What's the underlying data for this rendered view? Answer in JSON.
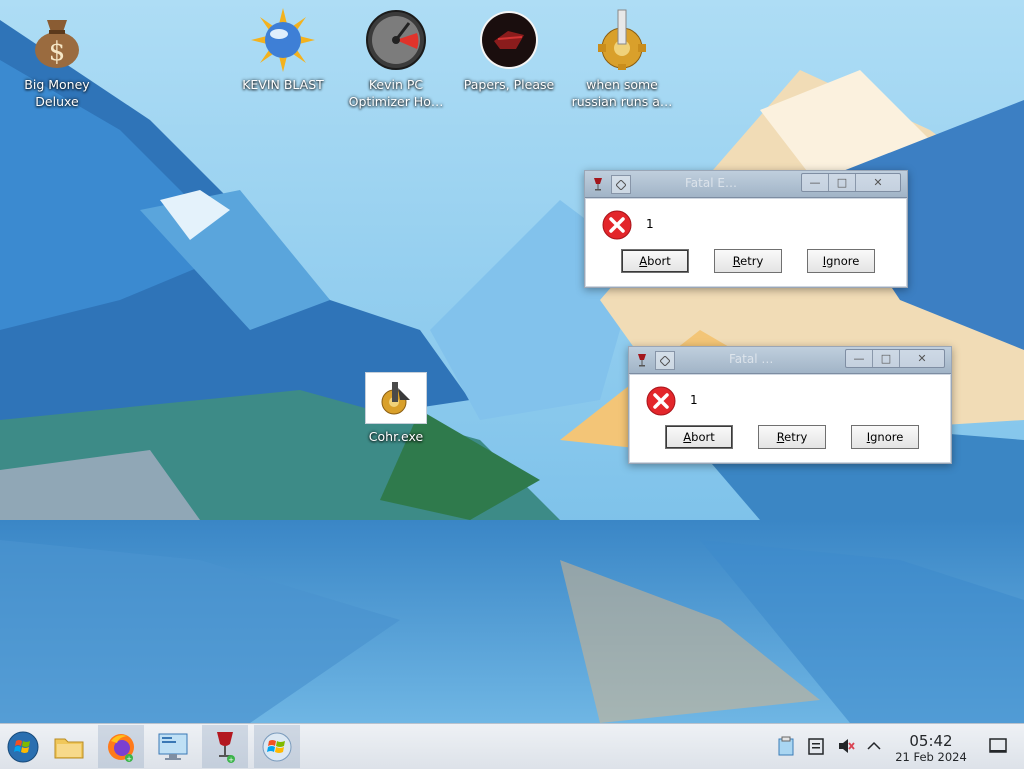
{
  "desktop": {
    "icons": [
      {
        "label": "Big Money Deluxe",
        "icon": "money-bag-icon"
      },
      {
        "label": "KEVIN BLAST",
        "icon": "sun-globe-icon"
      },
      {
        "label": "Kevin PC Optimizer Ho…",
        "icon": "speedometer-icon"
      },
      {
        "label": "Papers, Please",
        "icon": "papers-please-icon"
      },
      {
        "label": "when some russian runs a…",
        "icon": "gear-install-icon"
      },
      {
        "label": "Cohr.exe",
        "icon": "gear-install-icon"
      }
    ]
  },
  "dialogs": [
    {
      "title": "Fatal E…",
      "message": "1",
      "buttons": {
        "abort": "Abort",
        "retry": "Retry",
        "ignore": "Ignore"
      }
    },
    {
      "title": "Fatal …",
      "message": "1",
      "buttons": {
        "abort": "Abort",
        "retry": "Retry",
        "ignore": "Ignore"
      }
    }
  ],
  "taskbar": {
    "items": [
      "start-button",
      "file-manager",
      "firefox",
      "remote-desktop",
      "wine",
      "windows-logo"
    ],
    "tray": [
      "clipboard",
      "notes",
      "volume-muted",
      "show-hidden-chevron"
    ],
    "clock": {
      "time": "05:42",
      "date": "21 Feb 2024"
    }
  },
  "colors": {
    "error_red": "#e3262b",
    "taskbar_bg": "#e3e7ed"
  }
}
